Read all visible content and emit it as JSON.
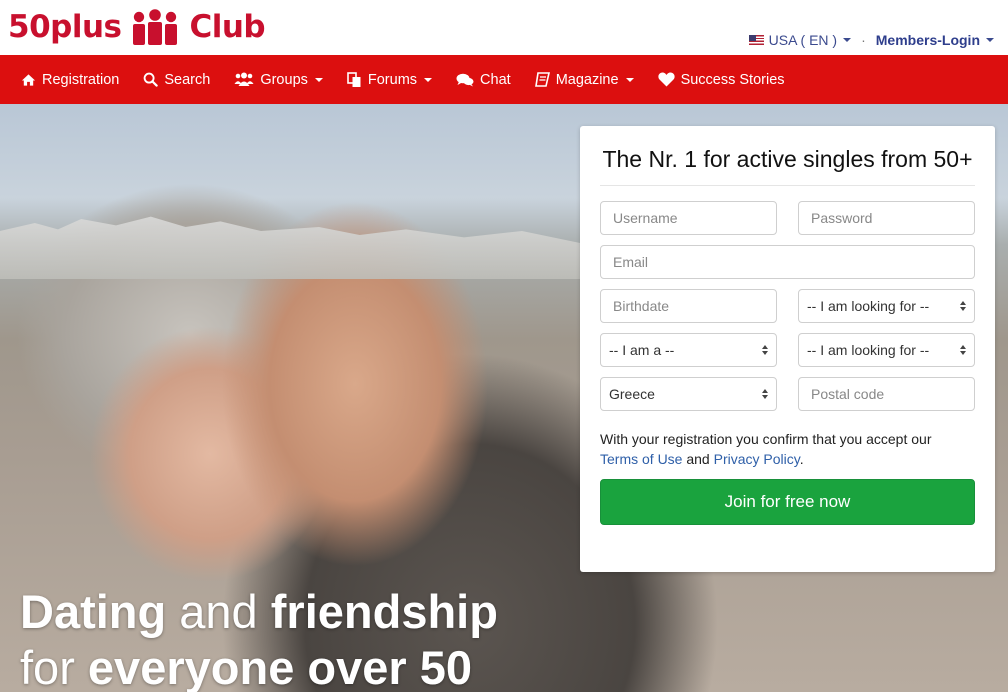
{
  "brand": {
    "name_left": "50plus",
    "name_right": "Club",
    "color": "#c8102e"
  },
  "topbar": {
    "language": "USA ( EN )",
    "separator": "·",
    "login": "Members-Login"
  },
  "nav": {
    "bg": "#dc0f0f",
    "items": [
      {
        "label": "Registration",
        "icon": "home-icon",
        "dropdown": false
      },
      {
        "label": "Search",
        "icon": "search-icon",
        "dropdown": false
      },
      {
        "label": "Groups",
        "icon": "users-icon",
        "dropdown": true
      },
      {
        "label": "Forums",
        "icon": "documents-icon",
        "dropdown": true
      },
      {
        "label": "Chat",
        "icon": "chat-icon",
        "dropdown": false
      },
      {
        "label": "Magazine",
        "icon": "book-icon",
        "dropdown": true
      },
      {
        "label": "Success Stories",
        "icon": "heart-icon",
        "dropdown": false
      }
    ]
  },
  "hero": {
    "line1_bold": "Dating",
    "line1_light": "and",
    "line1_bold2": "friendship",
    "line2_light": "for",
    "line2_bold": "everyone over 50"
  },
  "form": {
    "title": "The Nr. 1 for active singles from 50+",
    "username_placeholder": "Username",
    "password_placeholder": "Password",
    "email_placeholder": "Email",
    "birthdate_placeholder": "Birthdate",
    "looking_for_1": "-- I am looking for --",
    "i_am": "-- I am a --",
    "looking_for_2": "-- I am looking for --",
    "country": "Greece",
    "postal_placeholder": "Postal code",
    "terms_prefix": "With your registration you confirm that you accept our",
    "terms_link": "Terms of Use",
    "terms_and": "and",
    "privacy_link": "Privacy Policy",
    "terms_suffix": ".",
    "submit": "Join for free now",
    "submit_color": "#1aa33e"
  }
}
